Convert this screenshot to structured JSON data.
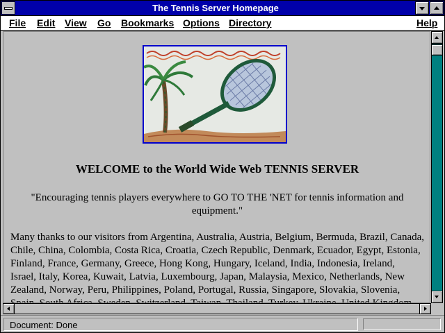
{
  "window": {
    "title": "The Tennis Server Homepage"
  },
  "menu": {
    "items": [
      "File",
      "Edit",
      "View",
      "Go",
      "Bookmarks",
      "Options",
      "Directory"
    ],
    "help": "Help"
  },
  "page": {
    "heading": "WELCOME to the World Wide Web TENNIS SERVER",
    "quote_line1": "\"Encouraging tennis players everywhere to GO TO THE 'NET for tennis information and",
    "quote_line2": "equipment.\"",
    "thanks_lines": [
      "Many thanks to our visitors from Argentina, Australia, Austria, Belgium, Bermuda, Brazil, Canada,",
      "Chile, China, Colombia, Costa Rica, Croatia, Czech Republic, Denmark, Ecuador, Egypt, Estonia,",
      "Finland, France, Germany, Greece, Hong Kong, Hungary, Iceland, India, Indonesia, Ireland,",
      "Israel, Italy, Korea, Kuwait, Latvia, Luxembourg, Japan, Malaysia, Mexico, Netherlands, New",
      "Zealand, Norway, Peru, Philippines, Poland, Portugal, Russia, Singapore, Slovakia, Slovenia,",
      "Spain, South Africa, Sweden, Switzerland, Taiwan, Thailand, Turkey, Ukraine, United Kingdom,"
    ]
  },
  "status": {
    "text": "Document: Done"
  },
  "colors": {
    "titlebar": "#0000aa",
    "scrollbar_track": "#008080",
    "banner_border": "#0000cc"
  },
  "icons": [
    "system-menu-icon",
    "minimize-icon",
    "maximize-icon",
    "scroll-up-icon",
    "scroll-down-icon",
    "scroll-left-icon",
    "scroll-right-icon"
  ]
}
